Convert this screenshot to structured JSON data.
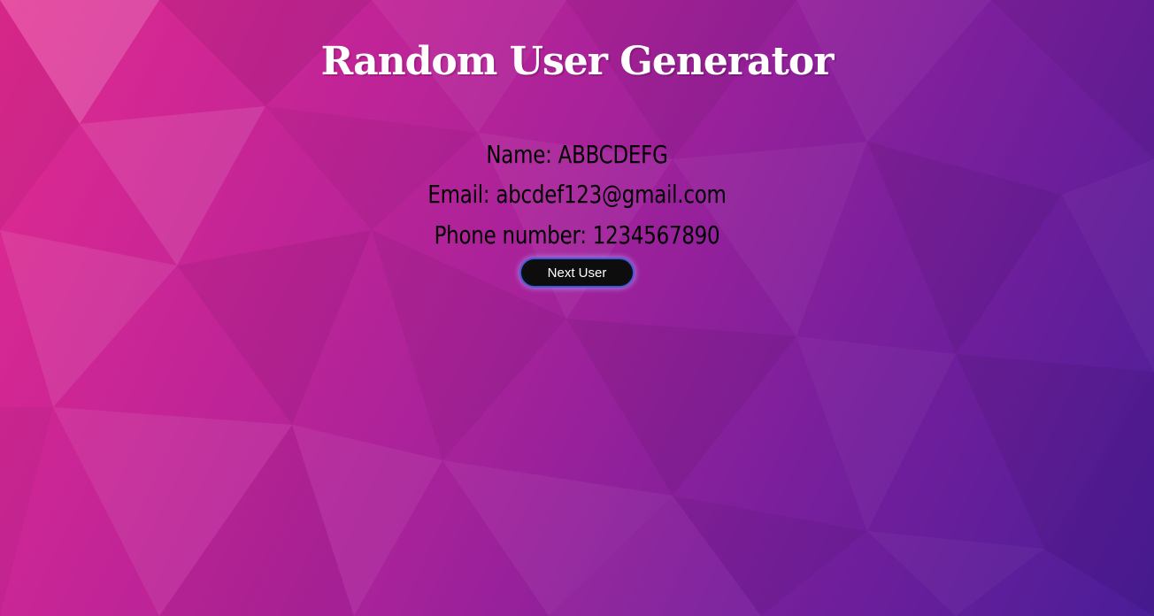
{
  "page": {
    "title": "Random User Generator"
  },
  "user": {
    "name_line": "Name: ABBCDEFG",
    "email_line": "Email: abcdef123@gmail.com",
    "phone_line": "Phone number: 1234567890"
  },
  "actions": {
    "next_label": "Next User"
  },
  "colors": {
    "background_start": "#e22a8f",
    "background_end": "#4a1d98",
    "title_text": "#ffffff",
    "info_text": "#000000",
    "button_bg": "#0d0d0d",
    "button_border": "#3b5bd6"
  }
}
